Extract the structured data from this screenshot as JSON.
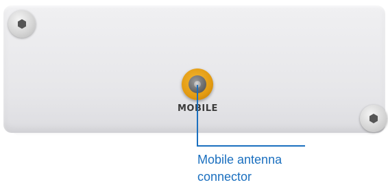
{
  "device": {
    "port_label": "MOBILE"
  },
  "callout": {
    "caption": "Mobile antenna connector",
    "color": "#1a6fbf"
  },
  "colors": {
    "connector": "#e39b12",
    "panel": "#e9e9ec"
  },
  "icons": [
    "hex-screw-icon",
    "sma-connector-icon"
  ]
}
